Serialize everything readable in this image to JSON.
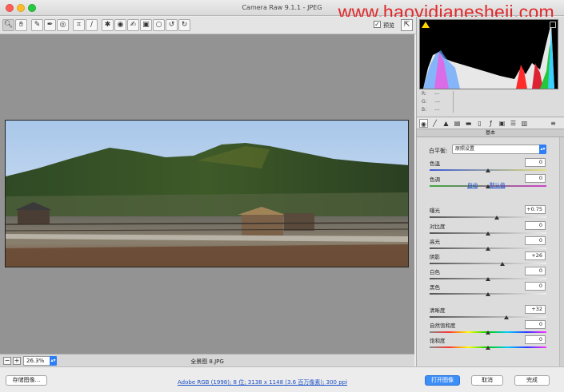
{
  "window": {
    "title": "Camera Raw 9.1.1  -  JPEG"
  },
  "watermark": "www.haoyidianesheji.com",
  "toolbar": {
    "tools": [
      "zoom-icon",
      "hand-icon",
      "white-balance-icon",
      "color-sampler-icon",
      "target-adjust-icon",
      "crop-icon",
      "straighten-icon",
      "spot-removal-icon",
      "red-eye-icon",
      "brush-icon",
      "graduated-filter-icon",
      "radial-filter-icon",
      "preferences-icon",
      "rotate-left-icon",
      "rotate-right-icon"
    ],
    "preview_label": "预览",
    "preview_checked": true
  },
  "status": {
    "zoom": "26.3%",
    "filename": "全景图 8.JPG"
  },
  "histogram": {
    "r": "---",
    "g": "---",
    "b": "---"
  },
  "panel": {
    "tabs": [
      "basic-icon",
      "tone-curve-icon",
      "detail-icon",
      "hsl-icon",
      "split-toning-icon",
      "lens-icon",
      "fx-icon",
      "camera-calibration-icon",
      "presets-icon",
      "snapshots-icon"
    ],
    "section_title": "基本",
    "wb_label": "白平衡:",
    "wb_value": "原照设置",
    "auto_link": "自动",
    "default_link": "默认值",
    "sliders": [
      {
        "label": "色温",
        "value": "0",
        "level": 0.5
      },
      {
        "label": "色调",
        "value": "0",
        "level": 0.5
      },
      {
        "label": "曝光",
        "value": "+0.75",
        "level": 0.58
      },
      {
        "label": "对比度",
        "value": "0",
        "level": 0.5
      },
      {
        "label": "高光",
        "value": "0",
        "level": 0.5
      },
      {
        "label": "阴影",
        "value": "+26",
        "level": 0.63
      },
      {
        "label": "白色",
        "value": "0",
        "level": 0.5
      },
      {
        "label": "黑色",
        "value": "0",
        "level": 0.5
      },
      {
        "label": "清晰度",
        "value": "+32",
        "level": 0.66
      },
      {
        "label": "自然饱和度",
        "value": "0",
        "level": 0.5
      },
      {
        "label": "饱和度",
        "value": "0",
        "level": 0.5
      }
    ]
  },
  "footer": {
    "save_button": "存储图像...",
    "workflow_link": "Adobe RGB (1998); 8 位; 3138 x 1148 (3.6 百万像素); 300 ppi",
    "open_button": "打开图像",
    "cancel_button": "取消",
    "done_button": "完成"
  },
  "colors": {
    "accent": "#3e8ef7",
    "link": "#1a4fc5",
    "watermark": "#e0282a"
  }
}
